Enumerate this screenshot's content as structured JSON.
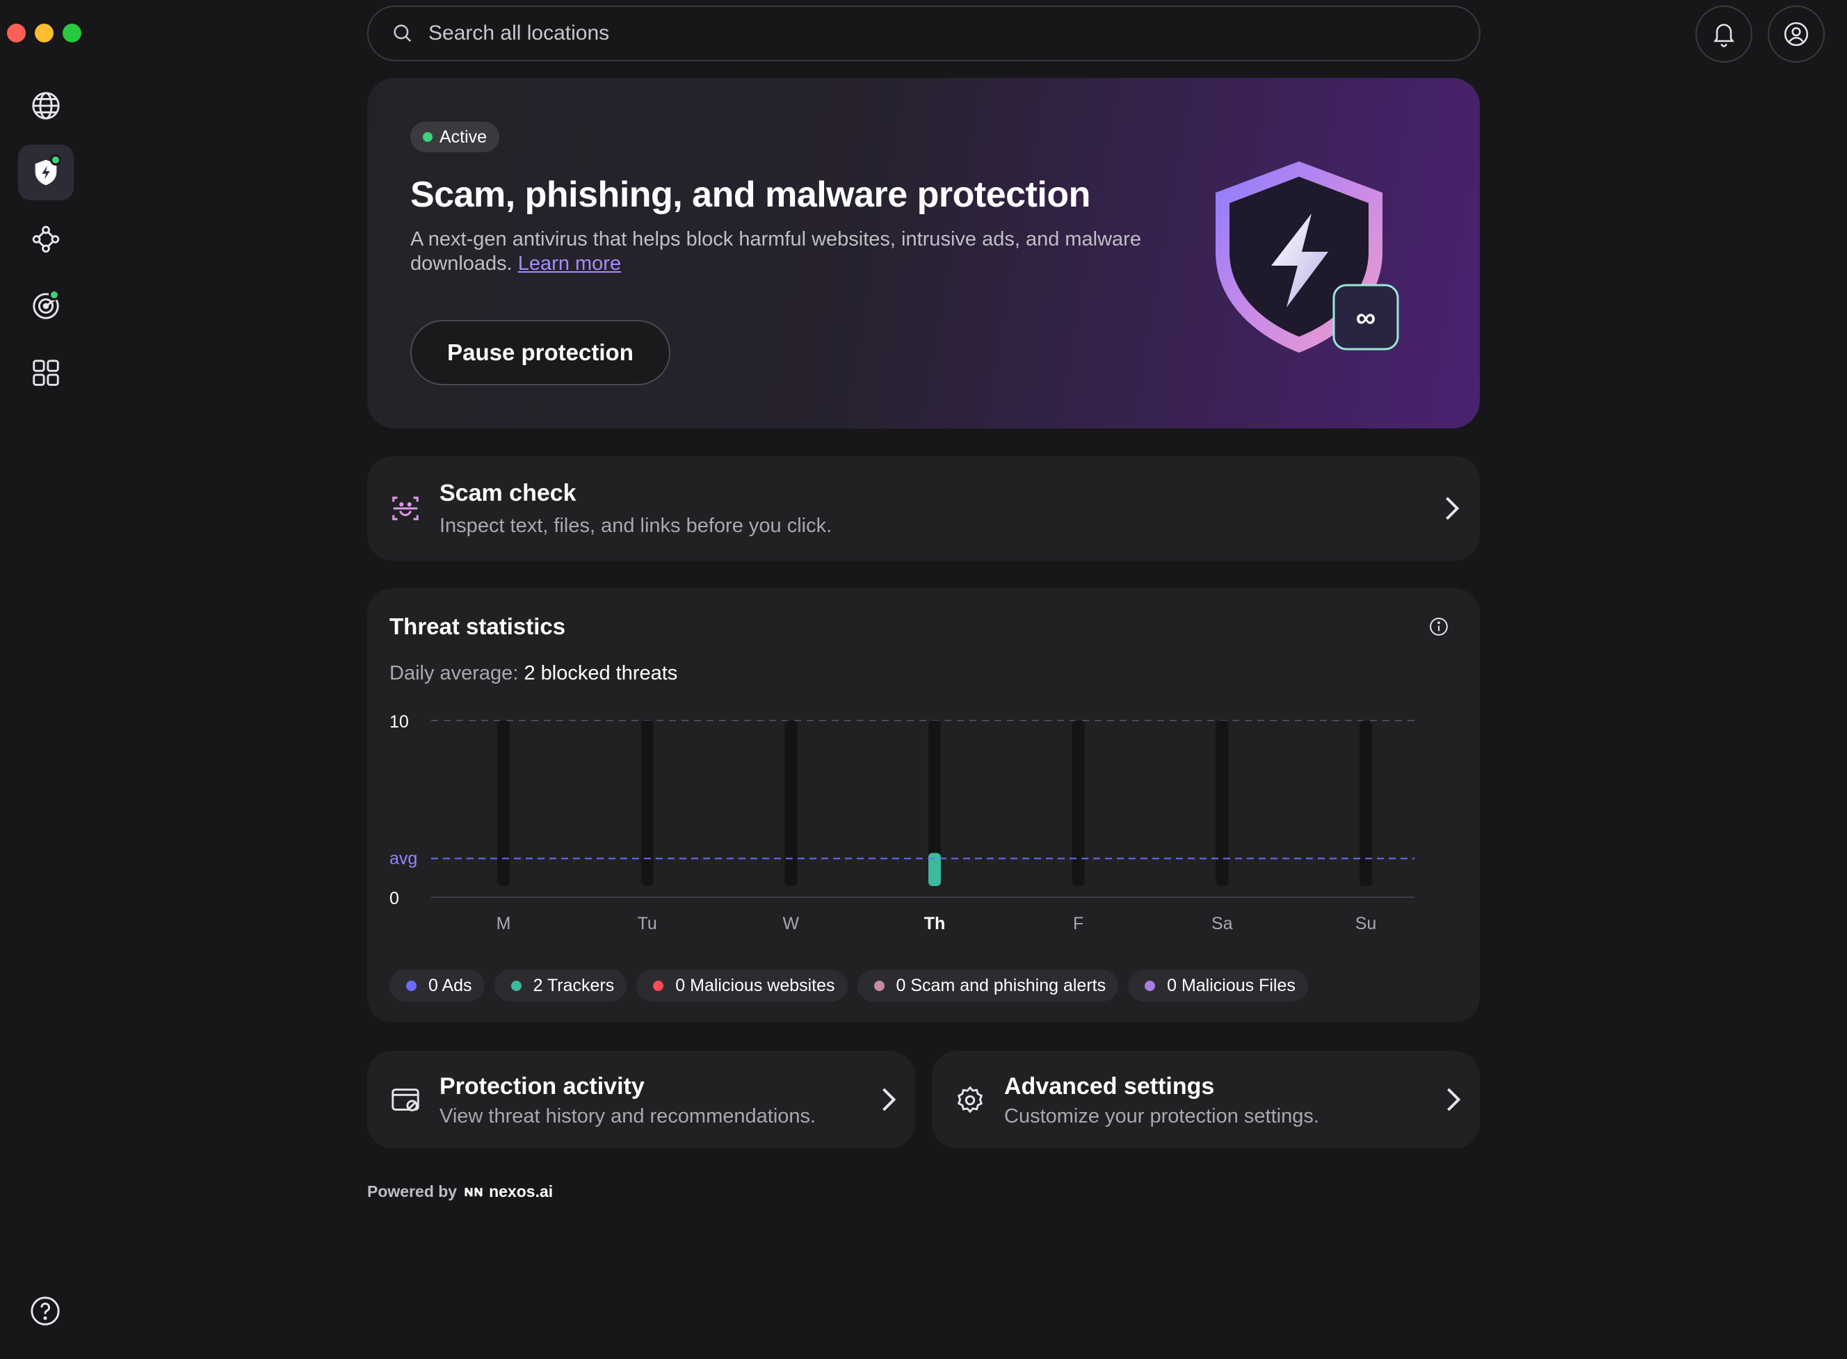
{
  "search": {
    "placeholder": "Search all locations"
  },
  "hero": {
    "badge": "Active",
    "title": "Scam, phishing, and malware protection",
    "description": "A next-gen antivirus that helps block harmful websites, intrusive ads, and malware downloads.",
    "learn_more": "Learn more",
    "pause_label": "Pause protection"
  },
  "scam_check": {
    "title": "Scam check",
    "subtitle": "Inspect text, files, and links before you click."
  },
  "threat_stats": {
    "title": "Threat statistics",
    "avg_label": "Daily average:",
    "avg_value": "2 blocked threats"
  },
  "chart_data": {
    "type": "bar",
    "categories": [
      "M",
      "Tu",
      "W",
      "Th",
      "F",
      "Sa",
      "Su"
    ],
    "values": [
      0,
      0,
      0,
      2,
      0,
      0,
      0
    ],
    "highlight": "Th",
    "ylim": [
      0,
      10
    ],
    "y_ticks": [
      "10",
      "0"
    ],
    "avg_label": "avg",
    "avg_value": 2,
    "bar_color": "#3fb8a0",
    "avg_line_color": "#6b6bff"
  },
  "legend": [
    {
      "label": "0 Ads",
      "color": "#6b6bff"
    },
    {
      "label": "2 Trackers",
      "color": "#3fb8a0"
    },
    {
      "label": "0 Malicious websites",
      "color": "#ff4b55"
    },
    {
      "label": "0 Scam and phishing alerts",
      "color": "#c78a9e"
    },
    {
      "label": "0 Malicious Files",
      "color": "#a77ee0"
    }
  ],
  "protection_activity": {
    "title": "Protection activity",
    "subtitle": "View threat history and recommendations."
  },
  "advanced_settings": {
    "title": "Advanced settings",
    "subtitle": "Customize your protection settings."
  },
  "footer": {
    "powered_by": "Powered by",
    "brand": "nexos.ai"
  }
}
